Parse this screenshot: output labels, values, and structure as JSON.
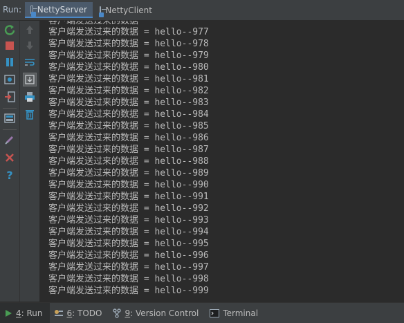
{
  "run_panel": {
    "label": "Run:",
    "tabs": [
      {
        "label": "NettyServer",
        "active": true
      },
      {
        "label": "NettyClient",
        "active": false
      }
    ]
  },
  "console": {
    "partial_top_line": "客户端发送过来的数据",
    "lines": [
      "客户端发送过来的数据 = hello--977",
      "客户端发送过来的数据 = hello--978",
      "客户端发送过来的数据 = hello--979",
      "客户端发送过来的数据 = hello--980",
      "客户端发送过来的数据 = hello--981",
      "客户端发送过来的数据 = hello--982",
      "客户端发送过来的数据 = hello--983",
      "客户端发送过来的数据 = hello--984",
      "客户端发送过来的数据 = hello--985",
      "客户端发送过来的数据 = hello--986",
      "客户端发送过来的数据 = hello--987",
      "客户端发送过来的数据 = hello--988",
      "客户端发送过来的数据 = hello--989",
      "客户端发送过来的数据 = hello--990",
      "客户端发送过来的数据 = hello--991",
      "客户端发送过来的数据 = hello--992",
      "客户端发送过来的数据 = hello--993",
      "客户端发送过来的数据 = hello--994",
      "客户端发送过来的数据 = hello--995",
      "客户端发送过来的数据 = hello--996",
      "客户端发送过来的数据 = hello--997",
      "客户端发送过来的数据 = hello--998",
      "客户端发送过来的数据 = hello--999"
    ]
  },
  "bottom_tabs": [
    {
      "key": "4",
      "label": ": Run",
      "icon": "run-icon",
      "active": true
    },
    {
      "key": "6",
      "label": ": TODO",
      "icon": "todo-icon",
      "active": false
    },
    {
      "key": "9",
      "label": ": Version Control",
      "icon": "version-control-icon",
      "active": false
    },
    {
      "key": "",
      "label": "Terminal",
      "icon": "terminal-icon",
      "active": false
    }
  ],
  "colors": {
    "background": "#2b2b2b",
    "panel": "#3c3f41",
    "text": "#bbbbbb",
    "run_green": "#499c54",
    "stop_red": "#c75450",
    "pause_blue": "#3592c4",
    "accent": "#4a88c7"
  }
}
